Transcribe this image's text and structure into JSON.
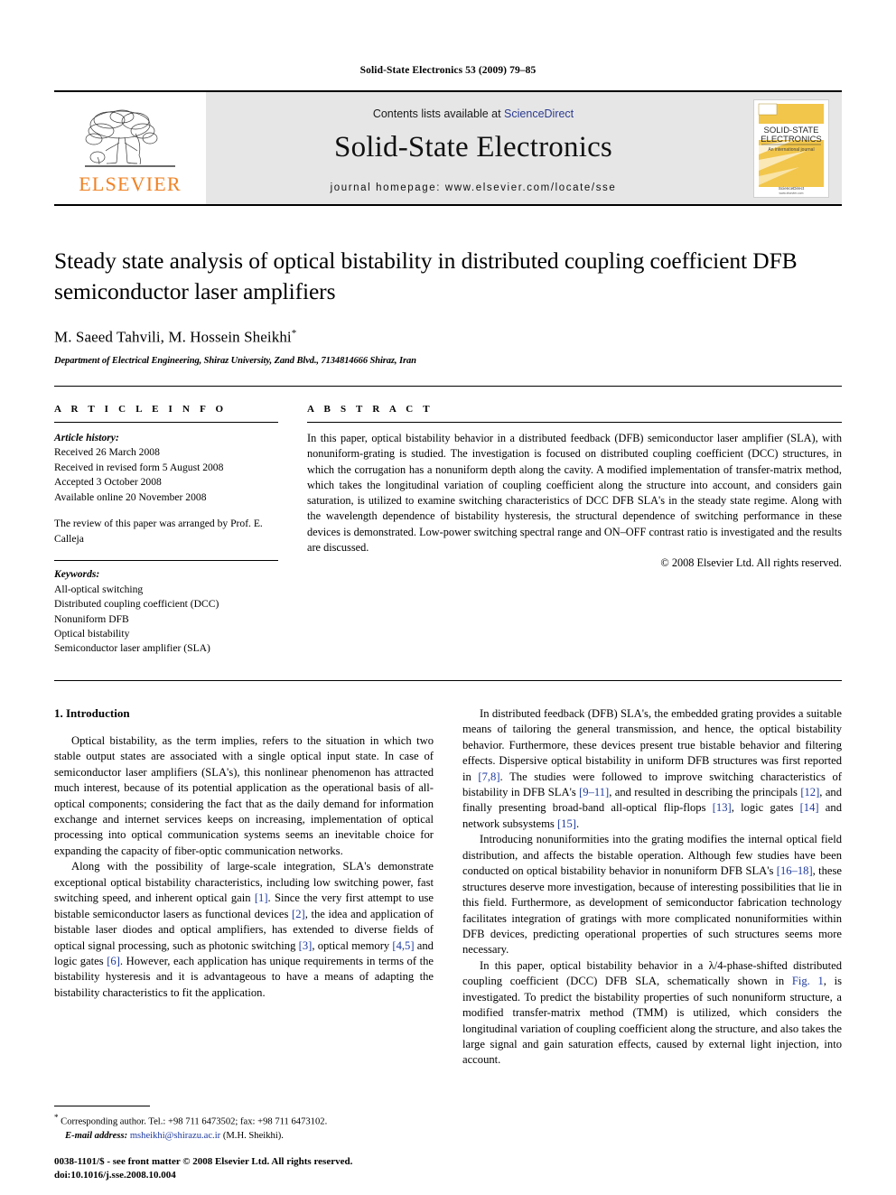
{
  "running_head": "Solid-State Electronics 53 (2009) 79–85",
  "masthead": {
    "publisher_name": "ELSEVIER",
    "contents_prefix": "Contents lists available at ",
    "contents_link": "ScienceDirect",
    "journal_title": "Solid-State Electronics",
    "homepage": "journal homepage: www.elsevier.com/locate/sse",
    "cover": {
      "line1": "SOLID-STATE",
      "line2": "ELECTRONICS",
      "subtitle": "An international journal",
      "footer": "ScienceDirect",
      "footer_sub": "www.elsevier.com"
    },
    "accent_orange": "#F08122",
    "link_blue": "#2b3a8f",
    "band_gray": "#e6e6e6"
  },
  "article": {
    "title": "Steady state analysis of optical bistability in distributed coupling coefficient DFB semiconductor laser amplifiers",
    "authors": "M. Saeed Tahvili, M. Hossein Sheikhi",
    "author_marker": "*",
    "affiliation": "Department of Electrical Engineering, Shiraz University, Zand Blvd., 7134814666 Shiraz, Iran"
  },
  "article_info": {
    "heading": "A R T I C L E   I N F O",
    "history_label": "Article history:",
    "history": [
      "Received 26 March 2008",
      "Received in revised form 5 August 2008",
      "Accepted 3 October 2008",
      "Available online 20 November 2008"
    ],
    "review_note": "The review of this paper was arranged by Prof. E. Calleja",
    "keywords_label": "Keywords:",
    "keywords": [
      "All-optical switching",
      "Distributed coupling coefficient (DCC)",
      "Nonuniform DFB",
      "Optical bistability",
      "Semiconductor laser amplifier (SLA)"
    ]
  },
  "abstract": {
    "heading": "A B S T R A C T",
    "text": "In this paper, optical bistability behavior in a distributed feedback (DFB) semiconductor laser amplifier (SLA), with nonuniform-grating is studied. The investigation is focused on distributed coupling coefficient (DCC) structures, in which the corrugation has a nonuniform depth along the cavity. A modified implementation of transfer-matrix method, which takes the longitudinal variation of coupling coefficient along the structure into account, and considers gain saturation, is utilized to examine switching characteristics of DCC DFB SLA's in the steady state regime. Along with the wavelength dependence of bistability hysteresis, the structural dependence of switching performance in these devices is demonstrated. Low-power switching spectral range and ON–OFF contrast ratio is investigated and the results are discussed.",
    "copyright": "© 2008 Elsevier Ltd. All rights reserved."
  },
  "body": {
    "section_heading": "1. Introduction",
    "left_paragraphs": [
      "Optical bistability, as the term implies, refers to the situation in which two stable output states are associated with a single optical input state. In case of semiconductor laser amplifiers (SLA's), this nonlinear phenomenon has attracted much interest, because of its potential application as the operational basis of all-optical components; considering the fact that as the daily demand for information exchange and internet services keeps on increasing, implementation of optical processing into optical communication systems seems an inevitable choice for expanding the capacity of fiber-optic communication networks.",
      "Along with the possibility of large-scale integration, SLA's demonstrate exceptional optical bistability characteristics, including low switching power, fast switching speed, and inherent optical gain [1]. Since the very first attempt to use bistable semiconductor lasers as functional devices [2], the idea and application of bistable laser diodes and optical amplifiers, has extended to diverse fields of optical signal processing, such as photonic switching [3], optical memory [4,5] and logic gates [6]. However, each application has unique requirements in terms of the bistability hysteresis and it is advantageous to have a means of adapting the bistability characteristics to fit the application."
    ],
    "right_paragraphs": [
      "In distributed feedback (DFB) SLA's, the embedded grating provides a suitable means of tailoring the general transmission, and hence, the optical bistability behavior. Furthermore, these devices present true bistable behavior and filtering effects. Dispersive optical bistability in uniform DFB structures was first reported in [7,8]. The studies were followed to improve switching characteristics of bistability in DFB SLA's [9–11], and resulted in describing the principals [12], and finally presenting broad-band all-optical flip-flops [13], logic gates [14] and network subsystems [15].",
      "Introducing nonuniformities into the grating modifies the internal optical field distribution, and affects the bistable operation. Although few studies have been conducted on optical bistability behavior in nonuniform DFB SLA's [16–18], these structures deserve more investigation, because of interesting possibilities that lie in this field. Furthermore, as development of semiconductor fabrication technology facilitates integration of gratings with more complicated nonuniformities within DFB devices, predicting operational properties of such structures seems more necessary.",
      "In this paper, optical bistability behavior in a λ/4-phase-shifted distributed coupling coefficient (DCC) DFB SLA, schematically shown in Fig. 1, is investigated. To predict the bistability properties of such nonuniform structure, a modified transfer-matrix method (TMM) is utilized, which considers the longitudinal variation of coupling coefficient along the structure, and also takes the large signal and gain saturation effects, caused by external light injection, into account."
    ]
  },
  "footnote": {
    "marker": "*",
    "text": "Corresponding author. Tel.: +98 711 6473502; fax: +98 711 6473102.",
    "email_label": "E-mail address:",
    "email": "msheikhi@shirazu.ac.ir",
    "email_owner": "(M.H. Sheikhi)."
  },
  "footer": {
    "issn_line": "0038-1101/$ - see front matter © 2008 Elsevier Ltd. All rights reserved.",
    "doi_line": "doi:10.1016/j.sse.2008.10.004"
  }
}
